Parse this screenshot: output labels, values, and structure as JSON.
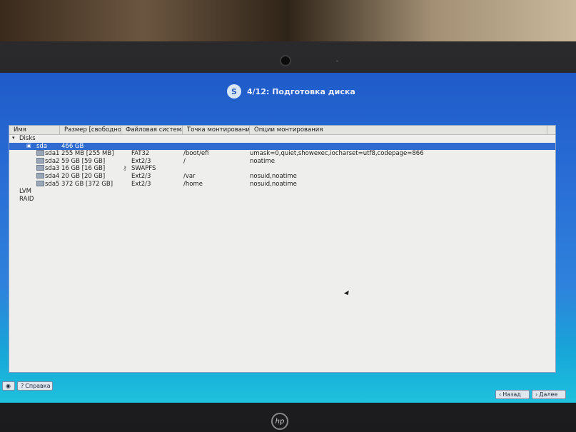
{
  "header": {
    "step": "4/12: Подготовка диска"
  },
  "columns": [
    "Имя",
    "Размер [свободно]",
    "Файловая система",
    "Точка монтирования",
    "Опции монтирования"
  ],
  "tree": {
    "disks_label": "Disks",
    "disk": {
      "name": "sda",
      "size": "466 GB"
    },
    "partitions": [
      {
        "name": "sda1",
        "size": "255 MB [255 MB]",
        "fs": "FAT32",
        "mount": "/boot/efi",
        "options": "umask=0,quiet,showexec,iocharset=utf8,codepage=866"
      },
      {
        "name": "sda2",
        "size": "59 GB [59 GB]",
        "fs": "Ext2/3",
        "mount": "/",
        "options": "noatime"
      },
      {
        "name": "sda3",
        "size": "16 GB [16 GB]",
        "fs": "SWAPFS",
        "mount": "",
        "options": ""
      },
      {
        "name": "sda4",
        "size": "20 GB [20 GB]",
        "fs": "Ext2/3",
        "mount": "/var",
        "options": "nosuid,noatime"
      },
      {
        "name": "sda5",
        "size": "372 GB [372 GB]",
        "fs": "Ext2/3",
        "mount": "/home",
        "options": "nosuid,noatime"
      }
    ],
    "lvm_label": "LVM",
    "raid_label": "RAID"
  },
  "bottom": {
    "help_label": "Справка",
    "back_label": "Назад",
    "next_label": "Далее"
  },
  "brand": "hp",
  "colors": {
    "selection": "#2f6bd1",
    "screen_top": "#1f5bc9",
    "screen_bottom": "#1ec1dd"
  },
  "icons": [
    "logo-icon",
    "expand-arrow-icon",
    "disk-icon",
    "partition-icon",
    "key-icon",
    "help-icon",
    "back-arrow-icon",
    "forward-arrow-icon"
  ]
}
